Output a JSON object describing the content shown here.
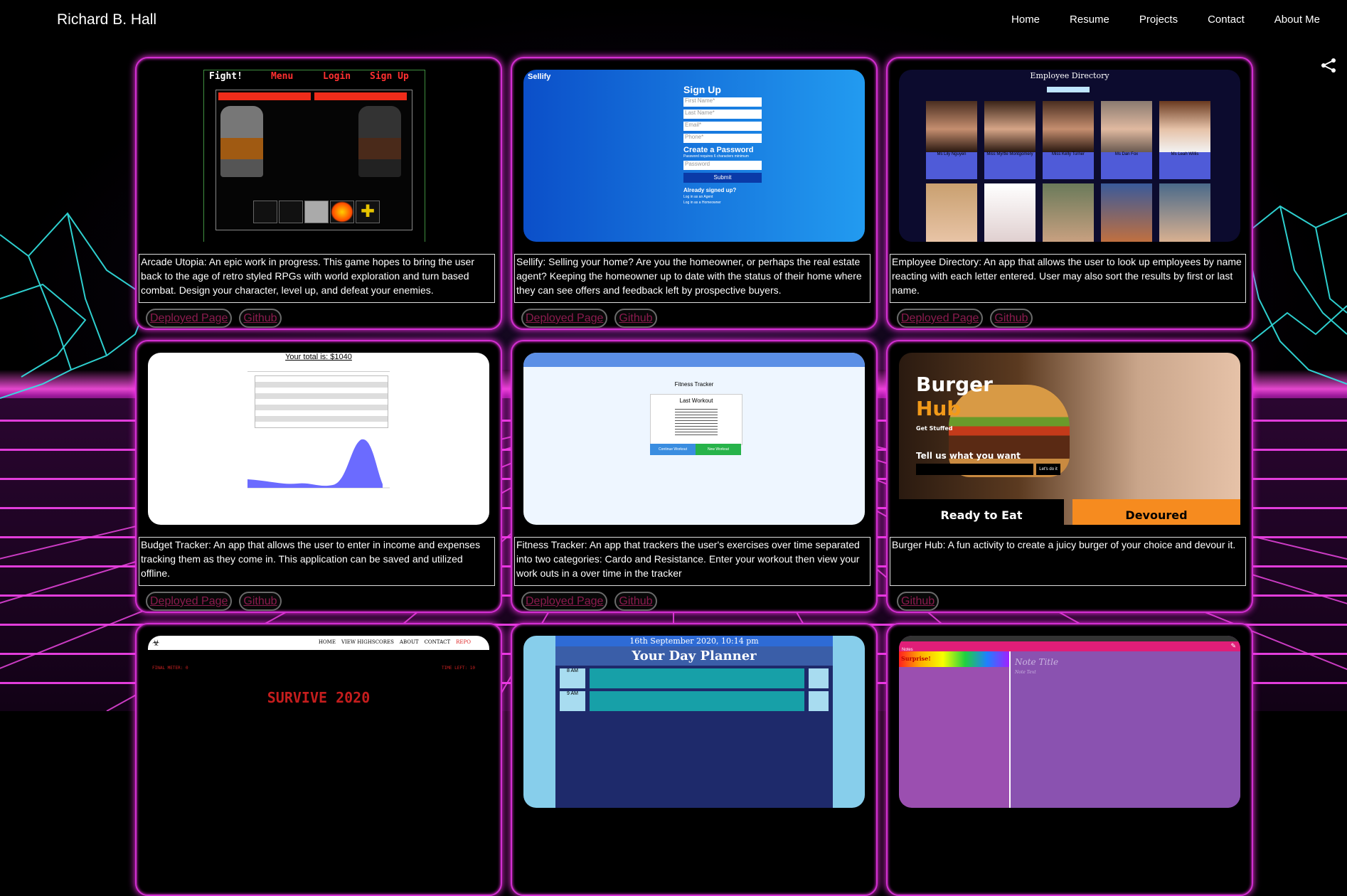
{
  "nav": {
    "brand": "Richard B. Hall",
    "items": [
      "Home",
      "Resume",
      "Projects",
      "Contact",
      "About Me"
    ]
  },
  "cards": [
    {
      "desc": "Arcade Utopia: An epic work in progress. This game hopes to bring the user back to the age of retro styled RPGs with world exploration and turn based combat. Design your character, level up, and defeat your enemies.",
      "links": [
        "Deployed Page",
        "Github"
      ],
      "shot": {
        "menu": [
          "Fight!",
          "Menu",
          "Login",
          "Sign Up"
        ]
      }
    },
    {
      "desc": "Sellify: Selling your home? Are you the homeowner, or perhaps the real estate agent? Keeping the homeowner up to date with the status of their home where they can see offers and feedback left by prospective buyers.",
      "links": [
        "Deployed Page",
        "Github"
      ],
      "shot": {
        "logo": "Sellify",
        "title": "Sign Up",
        "fields": [
          "First Name*",
          "Last Name*",
          "Email*",
          "Phone*"
        ],
        "subtitle": "Create a Password",
        "hint": "Password requires 6 characters minimum",
        "password": "Password",
        "submit": "Submit",
        "already": "Already signed up?",
        "login1": "Log in as an Agent",
        "login2": "Log in as a Homeowner"
      }
    },
    {
      "desc": "Employee Directory: An app that allows the user to look up employees by name reacting with each letter entered. User may also sort the results by first or last name.",
      "links": [
        "Deployed Page",
        "Github"
      ],
      "shot": {
        "title": "Employee Directory",
        "names": [
          "Ms Lily Nguyen",
          "Miss Myrtle Montgomery",
          "Miss Kelly Turner",
          "Ms Dan Fox",
          "Ms Leah Willis"
        ]
      }
    },
    {
      "desc": "Budget Tracker: An app that allows the user to enter in income and expenses tracking them as they come in. This application can be saved and utilized offline.",
      "links": [
        "Deployed Page",
        "Github"
      ],
      "shot": {
        "total": "Your total is: $1040"
      }
    },
    {
      "desc": "Fitness Tracker: An app that trackers the user's exercises over time separated into two categories: Cardo and Resistance. Enter your workout then view your work outs in a over time in the tracker",
      "links": [
        "Deployed Page",
        "Github"
      ],
      "shot": {
        "title": "Fitness Tracker",
        "box": "Last Workout",
        "btn1": "Continue Workout",
        "btn2": "New Workout"
      }
    },
    {
      "desc": "Burger Hub: A fun activity to create a juicy burger of your choice and devour it.",
      "links": [
        "Github"
      ],
      "shot": {
        "title1": "Burger",
        "title2": "Hub",
        "tag": "Get Stuffed",
        "prompt": "Tell us what you want",
        "go": "Let's do it",
        "left": "Ready to Eat",
        "right": "Devoured"
      }
    },
    {
      "desc": "",
      "links": [],
      "shot": {
        "menu": [
          "HOME",
          "VIEW HIGHSCORES",
          "ABOUT",
          "CONTACT",
          "REPO"
        ],
        "left": "FINAL METER: 0",
        "right": "TIME LEFT: 10",
        "title": "SURVIVE 2020"
      }
    },
    {
      "desc": "",
      "links": [],
      "shot": {
        "date": "16th September 2020, 10:14 pm",
        "title": "Your Day Planner",
        "rows": [
          "8 AM",
          "9 AM"
        ]
      }
    },
    {
      "desc": "",
      "links": [],
      "shot": {
        "brand": "Notes",
        "surprise": "Surprise!",
        "note_title": "Note Title",
        "note_text": "Note Text"
      }
    }
  ]
}
